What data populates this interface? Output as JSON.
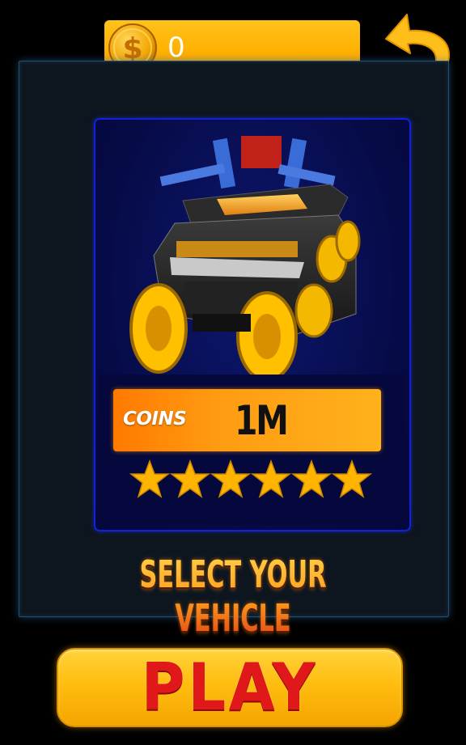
{
  "header": {
    "coin_count": "0",
    "coin_icon": "dollar-coin-icon",
    "back_icon": "curved-back-arrow-icon"
  },
  "vehicle": {
    "price_label": "COINS",
    "price_value": "1M",
    "stars": 6,
    "star_color": "#ffb400"
  },
  "title": "SELECT YOUR VEHICLE",
  "play_label": "PLAY",
  "colors": {
    "accent_gold": "#ffb400",
    "card_border": "#1322d8",
    "play_text": "#e0181a"
  }
}
